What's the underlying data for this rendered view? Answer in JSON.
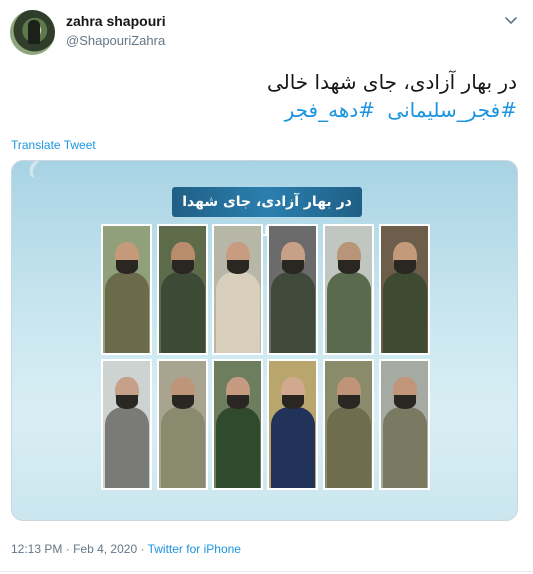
{
  "user": {
    "display_name": "zahra shapouri",
    "handle": "@ShapouriZahra"
  },
  "tweet": {
    "text_line1": "در بهار آزادی، جای شهدا خالی",
    "hashtags": [
      "#فجر_سلیمانی",
      "#دهه_فجر"
    ],
    "translate_label": "Translate Tweet"
  },
  "media": {
    "banner_text": "در بهار آزادی، جای شهدا خالی",
    "rows": 2,
    "columns": 6
  },
  "footer": {
    "time": "12:13 PM",
    "separator1": "·",
    "date": "Feb 4, 2020",
    "separator2": "·",
    "client": "Twitter for iPhone"
  },
  "colors": {
    "link": "#1b95e0",
    "secondary_text": "#657786",
    "primary_text": "#14171a"
  }
}
